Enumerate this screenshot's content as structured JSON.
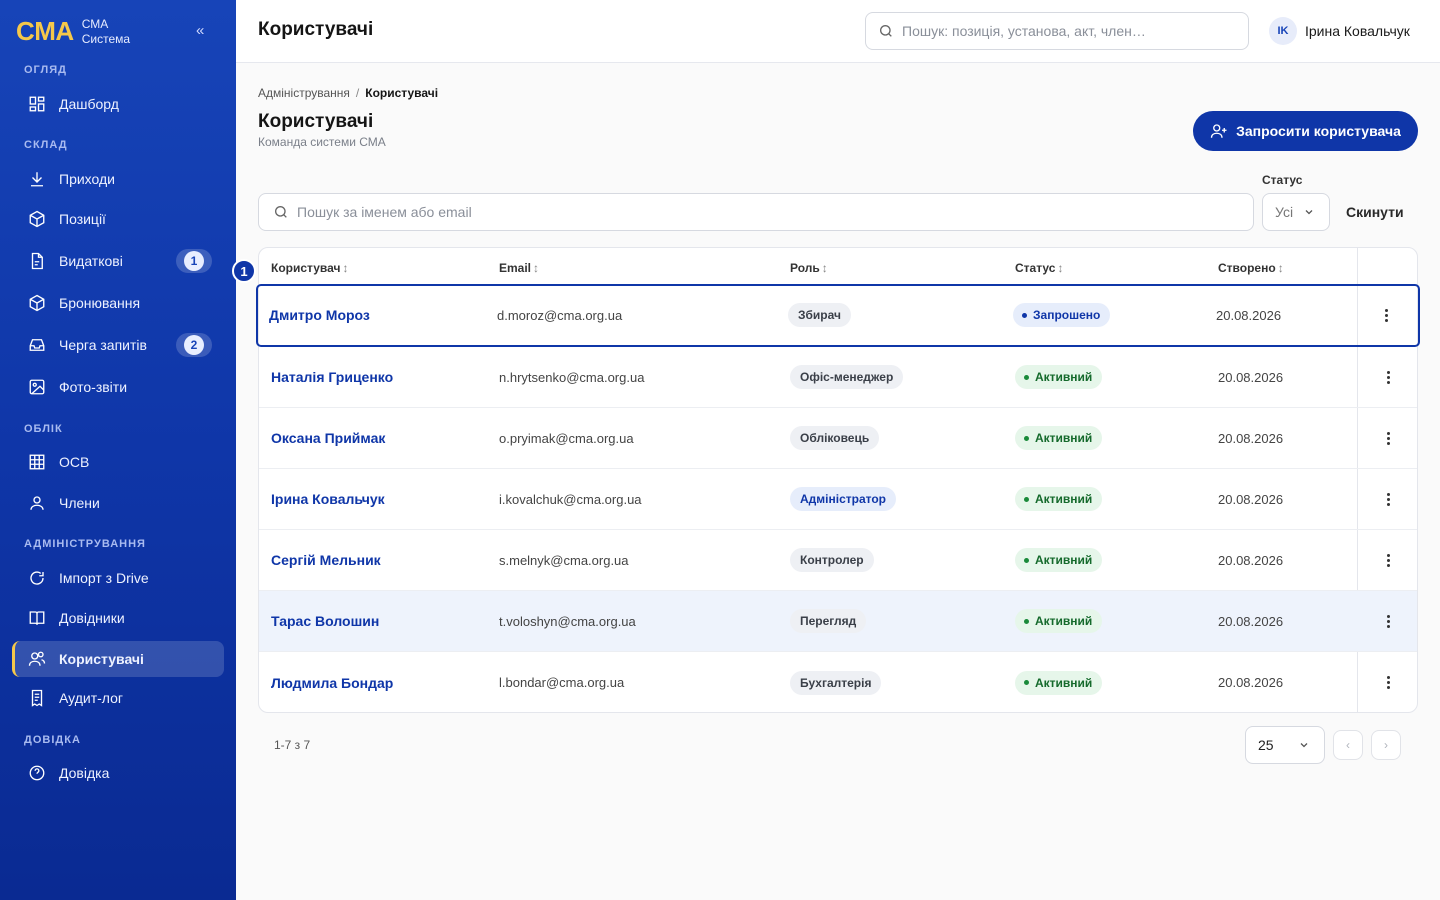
{
  "sidebar": {
    "brand_logo": "CMA",
    "brand_line1": "СМА",
    "brand_line2": "Система",
    "collapse_label": "«",
    "sections": {
      "overview": "ОГЛЯД",
      "warehouse": "СКЛАД",
      "accounting": "ОБЛІК",
      "admin": "АДМІНІСТРУВАННЯ",
      "help": "ДОВІДКА"
    },
    "items": {
      "dashboard": "Дашборд",
      "receipts": "Приходи",
      "positions": "Позиції",
      "expenses": "Видаткові",
      "expenses_badge": "1",
      "reservations": "Бронювання",
      "queue": "Черга запитів",
      "queue_badge": "2",
      "photo_reports": "Фото-звіти",
      "osv": "ОСВ",
      "members": "Члени",
      "drive_import": "Імпорт з Drive",
      "directories": "Довідники",
      "users": "Користувачі",
      "audit_log": "Аудит-лог",
      "help": "Довідка"
    }
  },
  "topbar": {
    "title": "Користувачі",
    "search_placeholder": "Пошук: позиція, установа, акт, член…",
    "user_initials": "IK",
    "user_name": "Ірина Ковальчук"
  },
  "page": {
    "breadcrumb_parent": "Адміністрування",
    "breadcrumb_sep": "/",
    "breadcrumb_current": "Користувачі",
    "title": "Користувачі",
    "subtitle": "Команда системи СМА",
    "invite_label": "Запросити користувача"
  },
  "filters": {
    "search_placeholder": "Пошук за іменем або email",
    "status_label": "Статус",
    "status_value": "Усі",
    "reset_label": "Скинути"
  },
  "table": {
    "columns": {
      "user": "Користувач",
      "email": "Email",
      "role": "Роль",
      "status": "Статус",
      "created": "Створено",
      "sort_glyph": "↕"
    },
    "tour_marker": "1",
    "rows": [
      {
        "name": "Дмитро Мороз",
        "email": "d.moroz@cma.org.ua",
        "role": "Збирач",
        "status": "Запрошено",
        "created": "20.08.2026"
      },
      {
        "name": "Наталія Гриценко",
        "email": "n.hrytsenko@cma.org.ua",
        "role": "Офіс-менеджер",
        "status": "Активний",
        "created": "20.08.2026"
      },
      {
        "name": "Оксана Приймак",
        "email": "o.pryimak@cma.org.ua",
        "role": "Обліковець",
        "status": "Активний",
        "created": "20.08.2026"
      },
      {
        "name": "Ірина Ковальчук",
        "email": "i.kovalchuk@cma.org.ua",
        "role": "Адміністратор",
        "status": "Активний",
        "created": "20.08.2026"
      },
      {
        "name": "Сергій Мельник",
        "email": "s.melnyk@cma.org.ua",
        "role": "Контролер",
        "status": "Активний",
        "created": "20.08.2026"
      },
      {
        "name": "Тарас Волошин",
        "email": "t.voloshyn@cma.org.ua",
        "role": "Перегляд",
        "status": "Активний",
        "created": "20.08.2026"
      },
      {
        "name": "Людмила Бондар",
        "email": "l.bondar@cma.org.ua",
        "role": "Бухгалтерія",
        "status": "Активний",
        "created": "20.08.2026"
      }
    ]
  },
  "pagination": {
    "range": "1-7 з 7",
    "per_page": "25",
    "prev": "‹",
    "next": "›"
  },
  "colors": {
    "brand_primary": "#0f36a8",
    "brand_accent": "#f5c84a",
    "status_active": "#1a8a3a"
  }
}
